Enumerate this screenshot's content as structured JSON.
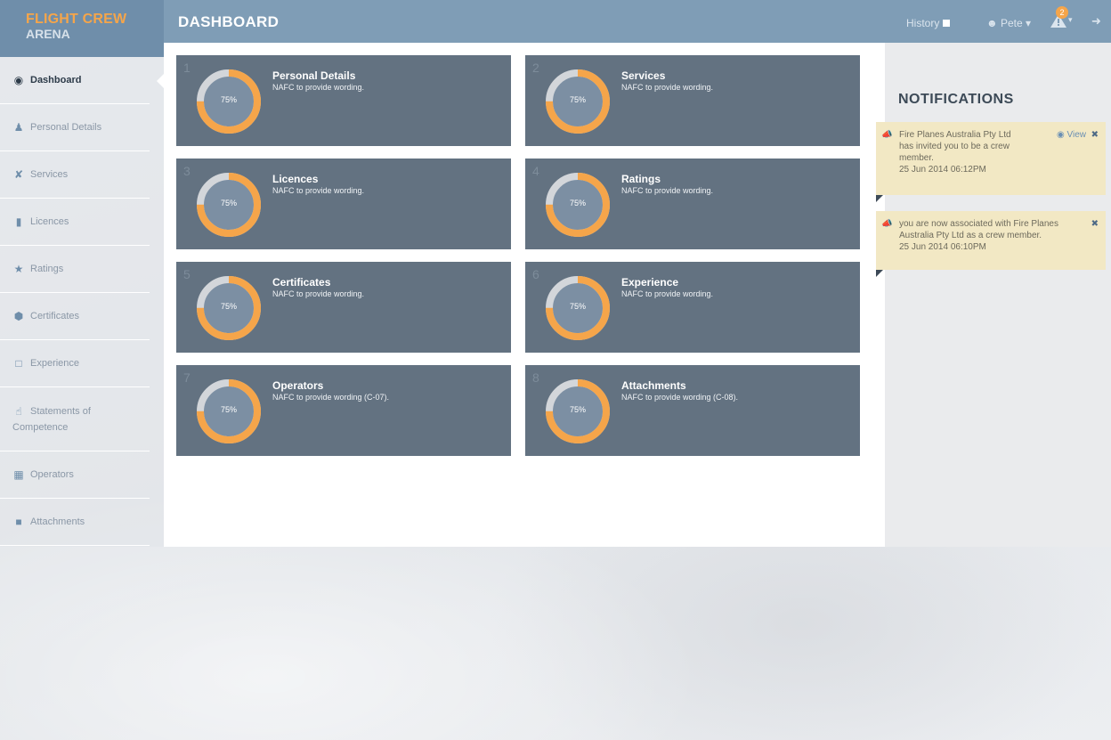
{
  "brand": {
    "line1": "FLIGHT CREW",
    "line2": "ARENA"
  },
  "header": {
    "title": "DASHBOARD",
    "history_label": "History",
    "user_label": "Pete",
    "alert_count": "2"
  },
  "sidebar": {
    "items": [
      {
        "label": "Dashboard",
        "icon": "dashboard-icon"
      },
      {
        "label": "Personal Details",
        "icon": "user-icon"
      },
      {
        "label": "Services",
        "icon": "services-icon"
      },
      {
        "label": "Licences",
        "icon": "licence-icon"
      },
      {
        "label": "Ratings",
        "icon": "star-icon"
      },
      {
        "label": "Certificates",
        "icon": "certificate-icon"
      },
      {
        "label": "Experience",
        "icon": "document-icon"
      },
      {
        "label": "Statements of",
        "label2": "Competence",
        "icon": "thumbs-up-icon"
      },
      {
        "label": "Operators",
        "icon": "building-icon"
      },
      {
        "label": "Attachments",
        "icon": "file-icon"
      }
    ]
  },
  "cards": [
    {
      "num": "1",
      "title": "Personal Details",
      "desc": "NAFC to provide wording.",
      "pct": "75%",
      "progress": 0.75
    },
    {
      "num": "2",
      "title": "Services",
      "desc": "NAFC to provide wording.",
      "pct": "75%",
      "progress": 0.75
    },
    {
      "num": "3",
      "title": "Licences",
      "desc": "NAFC to provide wording.",
      "pct": "75%",
      "progress": 0.75
    },
    {
      "num": "4",
      "title": "Ratings",
      "desc": "NAFC to provide wording.",
      "pct": "75%",
      "progress": 0.75
    },
    {
      "num": "5",
      "title": "Certificates",
      "desc": "NAFC to provide wording.",
      "pct": "75%",
      "progress": 0.75
    },
    {
      "num": "6",
      "title": "Experience",
      "desc": "NAFC to provide wording.",
      "pct": "75%",
      "progress": 0.75
    },
    {
      "num": "7",
      "title": "Operators",
      "desc": "NAFC to provide wording (C-07).",
      "pct": "75%",
      "progress": 0.75
    },
    {
      "num": "8",
      "title": "Attachments",
      "desc": "NAFC to provide wording (C-08).",
      "pct": "75%",
      "progress": 0.75
    }
  ],
  "notifications": {
    "title": "NOTIFICATIONS",
    "items": [
      {
        "line1": "Fire Planes Australia Pty Ltd",
        "line2": "has invited you to be a crew",
        "line3": "member.",
        "time": "25 Jun 2014 06:12PM",
        "view_label": "View"
      },
      {
        "line1": "you are now associated with Fire Planes",
        "line2": "Australia Pty Ltd as a crew member.",
        "time": "25 Jun 2014 06:10PM"
      }
    ]
  },
  "colors": {
    "accent": "#f5a54a",
    "header": "#7f9db6",
    "card": "#637281",
    "notification": "#f2e8c4"
  }
}
